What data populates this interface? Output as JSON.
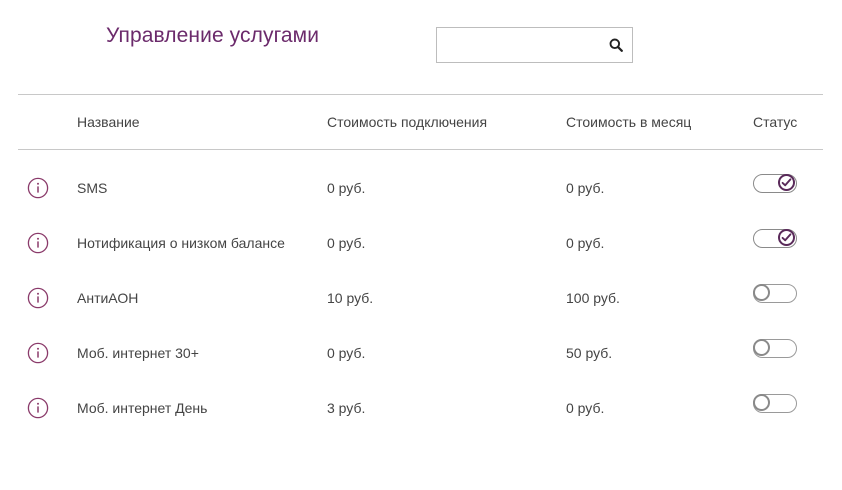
{
  "header": {
    "title": "Управление услугами",
    "search": {
      "value": "",
      "placeholder": ""
    },
    "search_icon": "search-icon"
  },
  "table": {
    "columns": {
      "name": "Название",
      "connection_cost": "Стоимость подключения",
      "monthly_cost": "Стоимость в месяц",
      "status": "Статус"
    },
    "rows": [
      {
        "name": "SMS",
        "connection_cost": "0 руб.",
        "monthly_cost": "0 руб.",
        "status_on": true
      },
      {
        "name": "Нотификация о низком балансе",
        "connection_cost": "0 руб.",
        "monthly_cost": "0 руб.",
        "status_on": true
      },
      {
        "name": "АнтиАОН",
        "connection_cost": "10 руб.",
        "monthly_cost": "100 руб.",
        "status_on": false
      },
      {
        "name": "Моб. интернет 30+",
        "connection_cost": "0 руб.",
        "monthly_cost": "50 руб.",
        "status_on": false
      },
      {
        "name": "Моб. интернет День",
        "connection_cost": "3 руб.",
        "monthly_cost": "0 руб.",
        "status_on": false
      }
    ]
  },
  "colors": {
    "accent": "#6b2a6b",
    "toggle_on": "#5a2a5a",
    "info_icon": "#8a3a6a",
    "divider": "#c8c8c8"
  },
  "icons": {
    "info": "info-icon",
    "check": "check-icon"
  }
}
